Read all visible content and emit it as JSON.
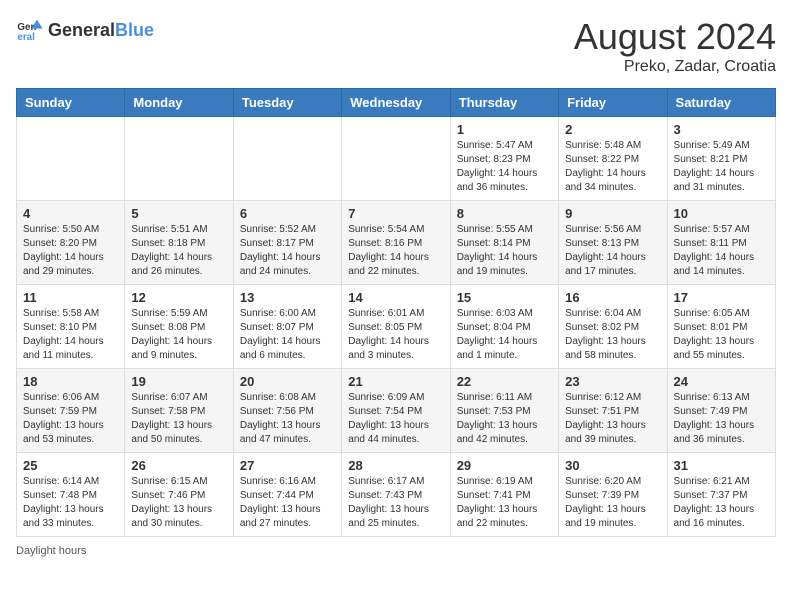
{
  "header": {
    "logo_general": "General",
    "logo_blue": "Blue",
    "title": "August 2024",
    "location": "Preko, Zadar, Croatia"
  },
  "calendar": {
    "days_of_week": [
      "Sunday",
      "Monday",
      "Tuesday",
      "Wednesday",
      "Thursday",
      "Friday",
      "Saturday"
    ],
    "weeks": [
      [
        {
          "day": "",
          "info": ""
        },
        {
          "day": "",
          "info": ""
        },
        {
          "day": "",
          "info": ""
        },
        {
          "day": "",
          "info": ""
        },
        {
          "day": "1",
          "info": "Sunrise: 5:47 AM\nSunset: 8:23 PM\nDaylight: 14 hours and 36 minutes."
        },
        {
          "day": "2",
          "info": "Sunrise: 5:48 AM\nSunset: 8:22 PM\nDaylight: 14 hours and 34 minutes."
        },
        {
          "day": "3",
          "info": "Sunrise: 5:49 AM\nSunset: 8:21 PM\nDaylight: 14 hours and 31 minutes."
        }
      ],
      [
        {
          "day": "4",
          "info": "Sunrise: 5:50 AM\nSunset: 8:20 PM\nDaylight: 14 hours and 29 minutes."
        },
        {
          "day": "5",
          "info": "Sunrise: 5:51 AM\nSunset: 8:18 PM\nDaylight: 14 hours and 26 minutes."
        },
        {
          "day": "6",
          "info": "Sunrise: 5:52 AM\nSunset: 8:17 PM\nDaylight: 14 hours and 24 minutes."
        },
        {
          "day": "7",
          "info": "Sunrise: 5:54 AM\nSunset: 8:16 PM\nDaylight: 14 hours and 22 minutes."
        },
        {
          "day": "8",
          "info": "Sunrise: 5:55 AM\nSunset: 8:14 PM\nDaylight: 14 hours and 19 minutes."
        },
        {
          "day": "9",
          "info": "Sunrise: 5:56 AM\nSunset: 8:13 PM\nDaylight: 14 hours and 17 minutes."
        },
        {
          "day": "10",
          "info": "Sunrise: 5:57 AM\nSunset: 8:11 PM\nDaylight: 14 hours and 14 minutes."
        }
      ],
      [
        {
          "day": "11",
          "info": "Sunrise: 5:58 AM\nSunset: 8:10 PM\nDaylight: 14 hours and 11 minutes."
        },
        {
          "day": "12",
          "info": "Sunrise: 5:59 AM\nSunset: 8:08 PM\nDaylight: 14 hours and 9 minutes."
        },
        {
          "day": "13",
          "info": "Sunrise: 6:00 AM\nSunset: 8:07 PM\nDaylight: 14 hours and 6 minutes."
        },
        {
          "day": "14",
          "info": "Sunrise: 6:01 AM\nSunset: 8:05 PM\nDaylight: 14 hours and 3 minutes."
        },
        {
          "day": "15",
          "info": "Sunrise: 6:03 AM\nSunset: 8:04 PM\nDaylight: 14 hours and 1 minute."
        },
        {
          "day": "16",
          "info": "Sunrise: 6:04 AM\nSunset: 8:02 PM\nDaylight: 13 hours and 58 minutes."
        },
        {
          "day": "17",
          "info": "Sunrise: 6:05 AM\nSunset: 8:01 PM\nDaylight: 13 hours and 55 minutes."
        }
      ],
      [
        {
          "day": "18",
          "info": "Sunrise: 6:06 AM\nSunset: 7:59 PM\nDaylight: 13 hours and 53 minutes."
        },
        {
          "day": "19",
          "info": "Sunrise: 6:07 AM\nSunset: 7:58 PM\nDaylight: 13 hours and 50 minutes."
        },
        {
          "day": "20",
          "info": "Sunrise: 6:08 AM\nSunset: 7:56 PM\nDaylight: 13 hours and 47 minutes."
        },
        {
          "day": "21",
          "info": "Sunrise: 6:09 AM\nSunset: 7:54 PM\nDaylight: 13 hours and 44 minutes."
        },
        {
          "day": "22",
          "info": "Sunrise: 6:11 AM\nSunset: 7:53 PM\nDaylight: 13 hours and 42 minutes."
        },
        {
          "day": "23",
          "info": "Sunrise: 6:12 AM\nSunset: 7:51 PM\nDaylight: 13 hours and 39 minutes."
        },
        {
          "day": "24",
          "info": "Sunrise: 6:13 AM\nSunset: 7:49 PM\nDaylight: 13 hours and 36 minutes."
        }
      ],
      [
        {
          "day": "25",
          "info": "Sunrise: 6:14 AM\nSunset: 7:48 PM\nDaylight: 13 hours and 33 minutes."
        },
        {
          "day": "26",
          "info": "Sunrise: 6:15 AM\nSunset: 7:46 PM\nDaylight: 13 hours and 30 minutes."
        },
        {
          "day": "27",
          "info": "Sunrise: 6:16 AM\nSunset: 7:44 PM\nDaylight: 13 hours and 27 minutes."
        },
        {
          "day": "28",
          "info": "Sunrise: 6:17 AM\nSunset: 7:43 PM\nDaylight: 13 hours and 25 minutes."
        },
        {
          "day": "29",
          "info": "Sunrise: 6:19 AM\nSunset: 7:41 PM\nDaylight: 13 hours and 22 minutes."
        },
        {
          "day": "30",
          "info": "Sunrise: 6:20 AM\nSunset: 7:39 PM\nDaylight: 13 hours and 19 minutes."
        },
        {
          "day": "31",
          "info": "Sunrise: 6:21 AM\nSunset: 7:37 PM\nDaylight: 13 hours and 16 minutes."
        }
      ]
    ]
  },
  "footer": {
    "daylight_label": "Daylight hours"
  }
}
